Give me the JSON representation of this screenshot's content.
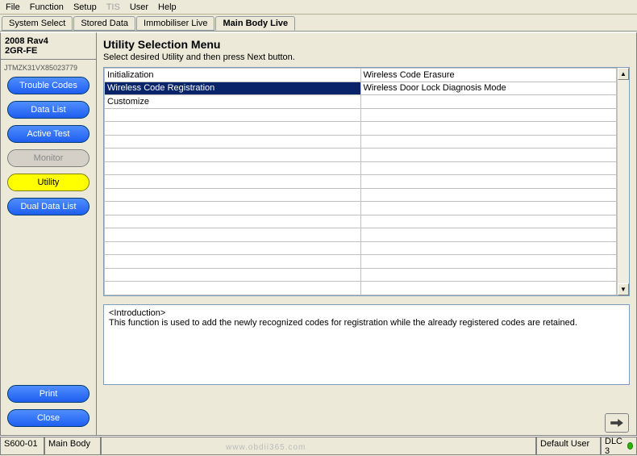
{
  "menu": {
    "file": "File",
    "function": "Function",
    "setup": "Setup",
    "tis": "TIS",
    "user": "User",
    "help": "Help"
  },
  "tabs": {
    "system_select": "System Select",
    "stored_data": "Stored Data",
    "immobiliser_live": "Immobiliser Live",
    "main_body_live": "Main Body Live"
  },
  "sidebar": {
    "vehicle_line1": "2008 Rav4",
    "vehicle_line2": "2GR-FE",
    "vin": "JTMZK31VX85023779",
    "buttons": {
      "trouble_codes": "Trouble Codes",
      "data_list": "Data List",
      "active_test": "Active Test",
      "monitor": "Monitor",
      "utility": "Utility",
      "dual_data_list": "Dual Data List",
      "print": "Print",
      "close": "Close"
    }
  },
  "content": {
    "title": "Utility Selection Menu",
    "subtitle": "Select desired Utility and then press Next button.",
    "table_rows": [
      {
        "col1": "Initialization",
        "col2": "Wireless Code Erasure"
      },
      {
        "col1": "Wireless Code Registration",
        "col2": "Wireless Door Lock Diagnosis Mode",
        "selected": true
      },
      {
        "col1": "Customize",
        "col2": ""
      }
    ],
    "selected_index": 1,
    "intro_label": "<Introduction>",
    "intro_text": "This function is used to add the newly recognized codes for registration while the already registered codes are retained."
  },
  "statusbar": {
    "code": "S600-01",
    "system": "Main Body",
    "user": "Default User",
    "conn": "DLC 3"
  },
  "watermark": "www.obdii365.com"
}
